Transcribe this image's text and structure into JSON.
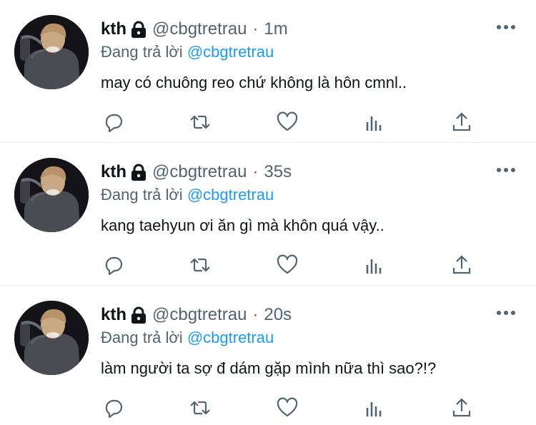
{
  "tweets": [
    {
      "name": "kth",
      "handle": "@cbgtretrau",
      "separator": "·",
      "time": "1m",
      "reply_prefix": "Đang trả lời",
      "reply_to": "@cbgtretrau",
      "text": "may có chuông reo chứ không là hôn cmnl.."
    },
    {
      "name": "kth",
      "handle": "@cbgtretrau",
      "separator": "·",
      "time": "35s",
      "reply_prefix": "Đang trả lời",
      "reply_to": "@cbgtretrau",
      "text": "kang taehyun ơi ăn gì mà khôn quá vậy.."
    },
    {
      "name": "kth",
      "handle": "@cbgtretrau",
      "separator": "·",
      "time": "20s",
      "reply_prefix": "Đang trả lời",
      "reply_to": "@cbgtretrau",
      "text": "làm người ta sợ đ dám gặp mình nữa thì sao?!?"
    }
  ],
  "icons": {
    "lock": "lock-icon",
    "more": "more-horizontal-icon",
    "reply": "reply-icon",
    "retweet": "retweet-icon",
    "like": "heart-icon",
    "views": "bar-chart-icon",
    "share": "share-icon"
  },
  "colors": {
    "text": "#0f1419",
    "secondary": "#536471",
    "link": "#1d9bf0",
    "divider": "#e6ecf0"
  }
}
